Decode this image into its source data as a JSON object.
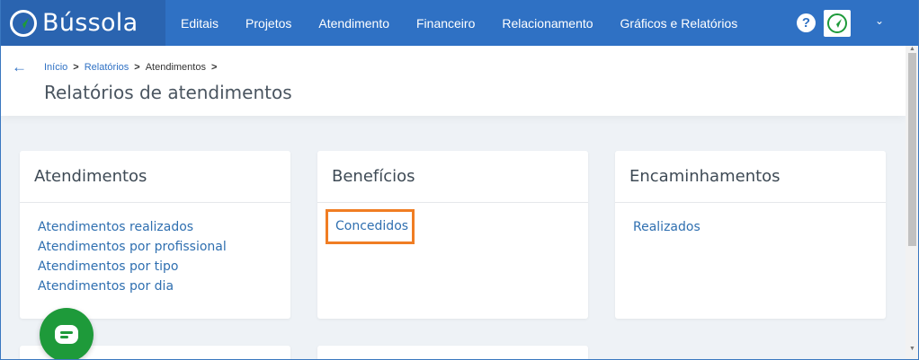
{
  "app": {
    "name": "Bússola"
  },
  "nav": {
    "items": [
      {
        "label": "Editais"
      },
      {
        "label": "Projetos"
      },
      {
        "label": "Atendimento"
      },
      {
        "label": "Financeiro"
      },
      {
        "label": "Relacionamento"
      },
      {
        "label": "Gráficos e Relatórios"
      }
    ],
    "help_icon": "?",
    "caret_icon": "⌄"
  },
  "breadcrumb": {
    "items": [
      "Início",
      "Relatórios",
      "Atendimentos"
    ],
    "separator": ">"
  },
  "page": {
    "title": "Relatórios de atendimentos"
  },
  "cards": [
    {
      "title": "Atendimentos",
      "links": [
        "Atendimentos realizados",
        "Atendimentos por profissional",
        "Atendimentos por tipo",
        "Atendimentos por dia"
      ]
    },
    {
      "title": "Benefícios",
      "links": [
        "Concedidos"
      ]
    },
    {
      "title": "Encaminhamentos",
      "links": [
        "Realizados"
      ]
    }
  ],
  "colors": {
    "primary": "#2f71c4",
    "brand_bg": "#2a64b0",
    "highlight": "#f07d23",
    "chat": "#1e9a3a"
  }
}
